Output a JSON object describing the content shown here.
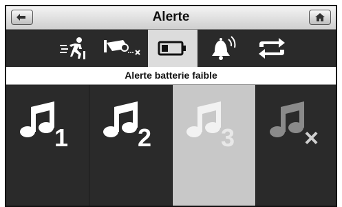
{
  "header": {
    "title": "Alerte"
  },
  "tabs": [
    {
      "icon": "motion-alert-icon",
      "active": false
    },
    {
      "icon": "camera-disconnected-icon",
      "active": false
    },
    {
      "icon": "battery-low-icon",
      "active": true
    },
    {
      "icon": "bell-alarm-icon",
      "active": false
    },
    {
      "icon": "repeat-icon",
      "active": false
    }
  ],
  "subtitle": "Alerte batterie faible",
  "options": [
    {
      "label": "1",
      "selected": false
    },
    {
      "label": "2",
      "selected": false
    },
    {
      "label": "3",
      "selected": true
    },
    {
      "label": "×",
      "selected": false
    }
  ],
  "colors": {
    "background": "#2a2a2a",
    "selected": "#c8c8c8",
    "active_tab": "#dcdcdc",
    "muted_icon": "#8a8a8a"
  }
}
